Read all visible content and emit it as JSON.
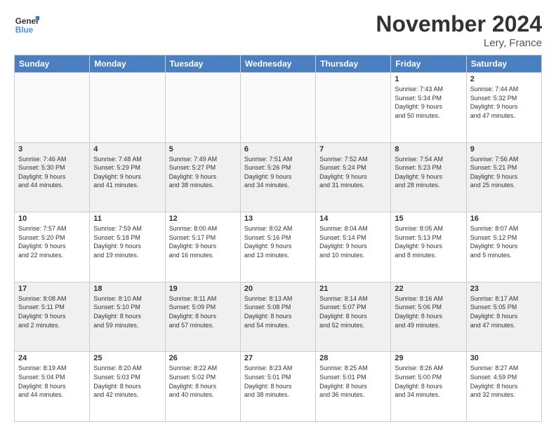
{
  "logo": {
    "text_general": "General",
    "text_blue": "Blue"
  },
  "header": {
    "month": "November 2024",
    "location": "Lery, France"
  },
  "weekdays": [
    "Sunday",
    "Monday",
    "Tuesday",
    "Wednesday",
    "Thursday",
    "Friday",
    "Saturday"
  ],
  "weeks": [
    [
      {
        "day": "",
        "info": ""
      },
      {
        "day": "",
        "info": ""
      },
      {
        "day": "",
        "info": ""
      },
      {
        "day": "",
        "info": ""
      },
      {
        "day": "",
        "info": ""
      },
      {
        "day": "1",
        "info": "Sunrise: 7:43 AM\nSunset: 5:34 PM\nDaylight: 9 hours\nand 50 minutes."
      },
      {
        "day": "2",
        "info": "Sunrise: 7:44 AM\nSunset: 5:32 PM\nDaylight: 9 hours\nand 47 minutes."
      }
    ],
    [
      {
        "day": "3",
        "info": "Sunrise: 7:46 AM\nSunset: 5:30 PM\nDaylight: 9 hours\nand 44 minutes."
      },
      {
        "day": "4",
        "info": "Sunrise: 7:48 AM\nSunset: 5:29 PM\nDaylight: 9 hours\nand 41 minutes."
      },
      {
        "day": "5",
        "info": "Sunrise: 7:49 AM\nSunset: 5:27 PM\nDaylight: 9 hours\nand 38 minutes."
      },
      {
        "day": "6",
        "info": "Sunrise: 7:51 AM\nSunset: 5:26 PM\nDaylight: 9 hours\nand 34 minutes."
      },
      {
        "day": "7",
        "info": "Sunrise: 7:52 AM\nSunset: 5:24 PM\nDaylight: 9 hours\nand 31 minutes."
      },
      {
        "day": "8",
        "info": "Sunrise: 7:54 AM\nSunset: 5:23 PM\nDaylight: 9 hours\nand 28 minutes."
      },
      {
        "day": "9",
        "info": "Sunrise: 7:56 AM\nSunset: 5:21 PM\nDaylight: 9 hours\nand 25 minutes."
      }
    ],
    [
      {
        "day": "10",
        "info": "Sunrise: 7:57 AM\nSunset: 5:20 PM\nDaylight: 9 hours\nand 22 minutes."
      },
      {
        "day": "11",
        "info": "Sunrise: 7:59 AM\nSunset: 5:18 PM\nDaylight: 9 hours\nand 19 minutes."
      },
      {
        "day": "12",
        "info": "Sunrise: 8:00 AM\nSunset: 5:17 PM\nDaylight: 9 hours\nand 16 minutes."
      },
      {
        "day": "13",
        "info": "Sunrise: 8:02 AM\nSunset: 5:16 PM\nDaylight: 9 hours\nand 13 minutes."
      },
      {
        "day": "14",
        "info": "Sunrise: 8:04 AM\nSunset: 5:14 PM\nDaylight: 9 hours\nand 10 minutes."
      },
      {
        "day": "15",
        "info": "Sunrise: 8:05 AM\nSunset: 5:13 PM\nDaylight: 9 hours\nand 8 minutes."
      },
      {
        "day": "16",
        "info": "Sunrise: 8:07 AM\nSunset: 5:12 PM\nDaylight: 9 hours\nand 5 minutes."
      }
    ],
    [
      {
        "day": "17",
        "info": "Sunrise: 8:08 AM\nSunset: 5:11 PM\nDaylight: 9 hours\nand 2 minutes."
      },
      {
        "day": "18",
        "info": "Sunrise: 8:10 AM\nSunset: 5:10 PM\nDaylight: 8 hours\nand 59 minutes."
      },
      {
        "day": "19",
        "info": "Sunrise: 8:11 AM\nSunset: 5:09 PM\nDaylight: 8 hours\nand 57 minutes."
      },
      {
        "day": "20",
        "info": "Sunrise: 8:13 AM\nSunset: 5:08 PM\nDaylight: 8 hours\nand 54 minutes."
      },
      {
        "day": "21",
        "info": "Sunrise: 8:14 AM\nSunset: 5:07 PM\nDaylight: 8 hours\nand 52 minutes."
      },
      {
        "day": "22",
        "info": "Sunrise: 8:16 AM\nSunset: 5:06 PM\nDaylight: 8 hours\nand 49 minutes."
      },
      {
        "day": "23",
        "info": "Sunrise: 8:17 AM\nSunset: 5:05 PM\nDaylight: 8 hours\nand 47 minutes."
      }
    ],
    [
      {
        "day": "24",
        "info": "Sunrise: 8:19 AM\nSunset: 5:04 PM\nDaylight: 8 hours\nand 44 minutes."
      },
      {
        "day": "25",
        "info": "Sunrise: 8:20 AM\nSunset: 5:03 PM\nDaylight: 8 hours\nand 42 minutes."
      },
      {
        "day": "26",
        "info": "Sunrise: 8:22 AM\nSunset: 5:02 PM\nDaylight: 8 hours\nand 40 minutes."
      },
      {
        "day": "27",
        "info": "Sunrise: 8:23 AM\nSunset: 5:01 PM\nDaylight: 8 hours\nand 38 minutes."
      },
      {
        "day": "28",
        "info": "Sunrise: 8:25 AM\nSunset: 5:01 PM\nDaylight: 8 hours\nand 36 minutes."
      },
      {
        "day": "29",
        "info": "Sunrise: 8:26 AM\nSunset: 5:00 PM\nDaylight: 8 hours\nand 34 minutes."
      },
      {
        "day": "30",
        "info": "Sunrise: 8:27 AM\nSunset: 4:59 PM\nDaylight: 8 hours\nand 32 minutes."
      }
    ]
  ]
}
